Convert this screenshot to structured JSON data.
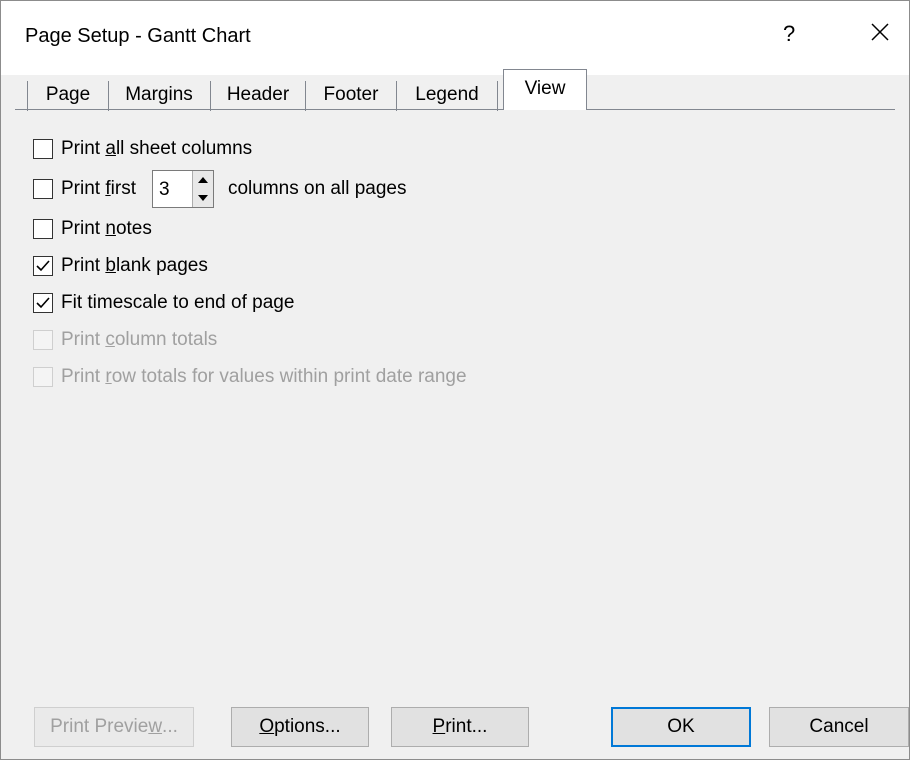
{
  "window": {
    "title": "Page Setup - Gantt Chart",
    "help_label": "?",
    "close_icon": "close-icon"
  },
  "tabs": [
    {
      "label": "Page",
      "active": false
    },
    {
      "label": "Margins",
      "active": false
    },
    {
      "label": "Header",
      "active": false
    },
    {
      "label": "Footer",
      "active": false
    },
    {
      "label": "Legend",
      "active": false
    },
    {
      "label": "View",
      "active": true
    }
  ],
  "options": {
    "print_all_sheet_columns": {
      "pre": "Print ",
      "key": "a",
      "post": "ll sheet columns",
      "checked": false,
      "enabled": true
    },
    "print_first": {
      "pre": "Print ",
      "key": "f",
      "post": "irst",
      "checked": false,
      "enabled": true,
      "value": "3",
      "suffix": "columns on all pages"
    },
    "print_notes": {
      "pre": "Print ",
      "key": "n",
      "post": "otes",
      "checked": false,
      "enabled": true
    },
    "print_blank_pages": {
      "pre": "Print ",
      "key": "b",
      "post": "lank pages",
      "checked": true,
      "enabled": true
    },
    "fit_timescale": {
      "pre": "Fit timescale to end of pa",
      "key": "g",
      "post": "e",
      "checked": true,
      "enabled": true
    },
    "print_column_totals": {
      "pre": "Print ",
      "key": "c",
      "post": "olumn totals",
      "checked": false,
      "enabled": false
    },
    "print_row_totals": {
      "pre": "Print ",
      "key": "r",
      "post": "ow totals for values within print date range",
      "checked": false,
      "enabled": false
    }
  },
  "buttons": {
    "print_preview": {
      "pre": "Print Previe",
      "key": "w",
      "post": "...",
      "enabled": false
    },
    "options": {
      "pre": "",
      "key": "O",
      "post": "ptions...",
      "enabled": true
    },
    "print": {
      "pre": "",
      "key": "P",
      "post": "rint...",
      "enabled": true
    },
    "ok": {
      "label": "OK",
      "default": true
    },
    "cancel": {
      "label": "Cancel"
    }
  },
  "colors": {
    "accent": "#0078d7",
    "disabled_text": "#a0a0a0"
  }
}
